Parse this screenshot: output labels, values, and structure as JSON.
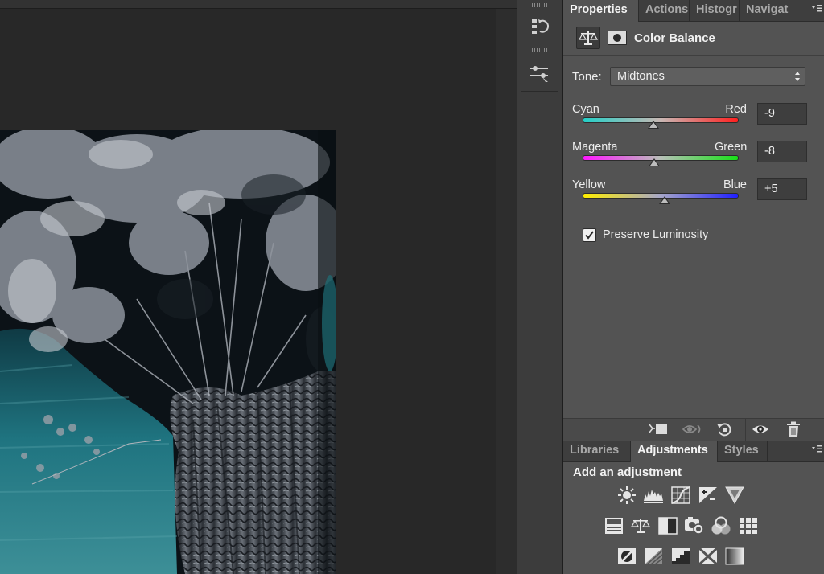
{
  "colors": {
    "panel_bg": "#535353",
    "tabbar_bg": "#3e3e3e",
    "canvas_bg": "#282828",
    "photo_teal": "#1f7a83"
  },
  "properties_panel": {
    "tabs": [
      {
        "label": "Properties",
        "active": true
      },
      {
        "label": "Actions",
        "active": false
      },
      {
        "label": "Histogr",
        "active": false
      },
      {
        "label": "Navigat",
        "active": false
      }
    ],
    "header": {
      "title": "Color Balance",
      "icons": [
        "scales-icon",
        "layer-mask-icon"
      ]
    },
    "tone": {
      "label": "Tone:",
      "selected": "Midtones"
    },
    "sliders": [
      {
        "left_label": "Cyan",
        "right_label": "Red",
        "value": "-9",
        "level": -9,
        "gradient": [
          "#24cfc7",
          "#c8b8b4",
          "#ff2020"
        ]
      },
      {
        "left_label": "Magenta",
        "right_label": "Green",
        "value": "-8",
        "level": -8,
        "gradient": [
          "#ff18ff",
          "#b8c0b8",
          "#18e018"
        ]
      },
      {
        "left_label": "Yellow",
        "right_label": "Blue",
        "value": "+5",
        "level": 5,
        "gradient": [
          "#ffee00",
          "#a6a6c8",
          "#2020ff"
        ]
      }
    ],
    "slider_range": [
      -100,
      100
    ],
    "preserve_luminosity": {
      "label": "Preserve Luminosity",
      "checked": true
    },
    "footer_icons": [
      "clip-to-layer-icon",
      "view-previous-state-icon",
      "reset-icon",
      "toggle-visibility-icon",
      "delete-icon"
    ]
  },
  "adjustments_panel": {
    "tabs": [
      {
        "label": "Libraries",
        "active": false
      },
      {
        "label": "Adjustments",
        "active": true
      },
      {
        "label": "Styles",
        "active": false
      }
    ],
    "title": "Add an adjustment",
    "icon_rows": [
      [
        "brightness-contrast-icon",
        "levels-icon",
        "curves-icon",
        "exposure-icon",
        "triangle-icon"
      ],
      [
        "hue-saturation-icon",
        "color-balance-icon",
        "black-white-icon",
        "photo-filter-icon",
        "channel-mixer-icon",
        "color-lookup-icon"
      ],
      [
        "invert-icon",
        "posterize-icon",
        "threshold-icon",
        "selective-color-icon",
        "gradient-map-icon"
      ]
    ]
  },
  "dock": {
    "icons": [
      "history-icon",
      "adjustment-sliders-icon"
    ]
  }
}
